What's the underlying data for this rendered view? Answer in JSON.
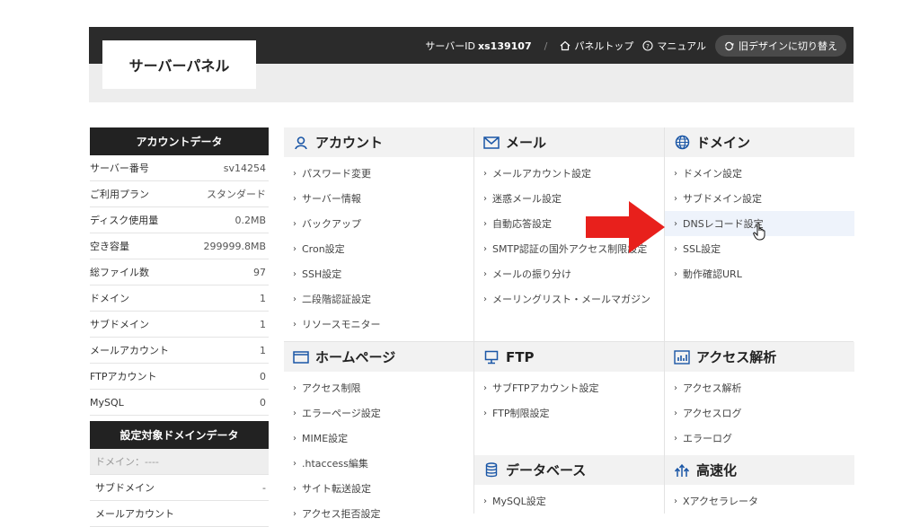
{
  "header": {
    "title": "サーバーパネル",
    "server_id_label": "サーバーID",
    "server_id": "xs139107",
    "separator": "/",
    "panel_top": "パネルトップ",
    "manual": "マニュアル",
    "old_design": "旧デザインに切り替え"
  },
  "sidebar": {
    "account_title": "アカウントデータ",
    "account_rows": [
      {
        "label": "サーバー番号",
        "value": "sv14254"
      },
      {
        "label": "ご利用プラン",
        "value": "スタンダード"
      },
      {
        "label": "ディスク使用量",
        "value": "0.2MB"
      },
      {
        "label": "空き容量",
        "value": "299999.8MB"
      },
      {
        "label": "総ファイル数",
        "value": "97"
      },
      {
        "label": "ドメイン",
        "value": "1"
      },
      {
        "label": "サブドメイン",
        "value": "1"
      },
      {
        "label": "メールアカウント",
        "value": "1"
      },
      {
        "label": "FTPアカウント",
        "value": "0"
      },
      {
        "label": "MySQL",
        "value": "0"
      }
    ],
    "domain_title": "設定対象ドメインデータ",
    "domain_rows": [
      {
        "label": "ドメイン：----",
        "value": ""
      },
      {
        "label": "サブドメイン",
        "value": "-"
      },
      {
        "label": "メールアカウント",
        "value": ""
      }
    ]
  },
  "sections": {
    "account": {
      "title": "アカウント",
      "items": [
        "パスワード変更",
        "サーバー情報",
        "バックアップ",
        "Cron設定",
        "SSH設定",
        "二段階認証設定",
        "リソースモニター"
      ]
    },
    "mail": {
      "title": "メール",
      "items": [
        "メールアカウント設定",
        "迷惑メール設定",
        "自動応答設定",
        "SMTP認証の国外アクセス制限設定",
        "メールの振り分け",
        "メーリングリスト・メールマガジン"
      ]
    },
    "domain": {
      "title": "ドメイン",
      "items": [
        "ドメイン設定",
        "サブドメイン設定",
        "DNSレコード設定",
        "SSL設定",
        "動作確認URL"
      ]
    },
    "homepage": {
      "title": "ホームページ",
      "items": [
        "アクセス制限",
        "エラーページ設定",
        "MIME設定",
        ".htaccess編集",
        "サイト転送設定",
        "アクセス拒否設定"
      ]
    },
    "ftp": {
      "title": "FTP",
      "items": [
        "サブFTPアカウント設定",
        "FTP制限設定"
      ]
    },
    "access": {
      "title": "アクセス解析",
      "items": [
        "アクセス解析",
        "アクセスログ",
        "エラーログ"
      ]
    },
    "database": {
      "title": "データベース",
      "items": [
        "MySQL設定"
      ]
    },
    "speed": {
      "title": "高速化",
      "items": [
        "Xアクセラレータ"
      ]
    }
  },
  "colors": {
    "accent_arrow": "#e8201c",
    "header_bg": "#2b2b2b",
    "sidebar_head": "#222222"
  }
}
